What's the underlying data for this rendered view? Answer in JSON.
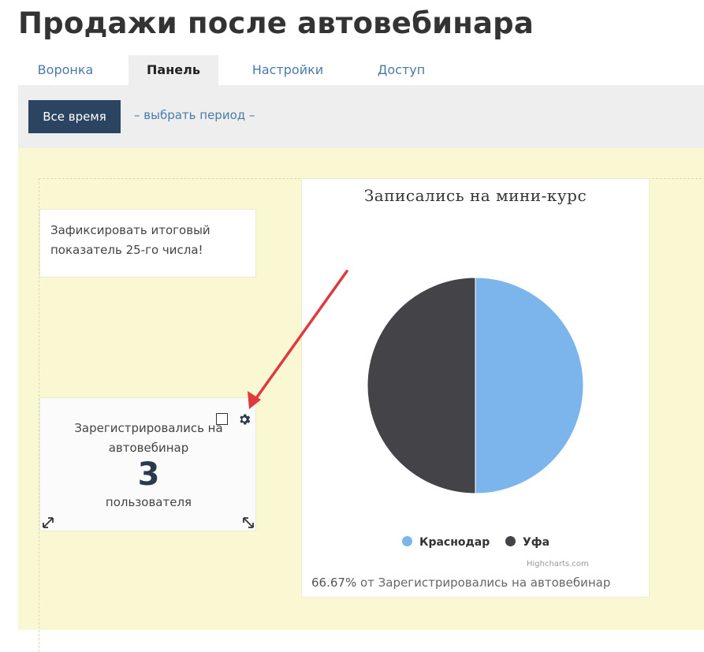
{
  "page": {
    "title": "Продажи после автовебинара"
  },
  "tabs": [
    {
      "label": "Воронка",
      "active": false
    },
    {
      "label": "Панель",
      "active": true
    },
    {
      "label": "Настройки",
      "active": false
    },
    {
      "label": "Доступ",
      "active": false
    }
  ],
  "period": {
    "all_time_label": "Все время",
    "choose_label": "– выбрать период –"
  },
  "note": {
    "text": "Зафиксировать итоговый показатель 25-го числа!"
  },
  "kpi": {
    "title": "Зарегистрировались на автовебинар",
    "value": "3",
    "unit": "пользователя",
    "icons": [
      "checkbox-icon",
      "gear-icon",
      "expand-diagonal-icon",
      "resize-diagonal-icon"
    ]
  },
  "chart_data": {
    "type": "pie",
    "title": "Записались на мини-курс",
    "categories": [
      "Краснодар",
      "Уфа"
    ],
    "values": [
      50,
      50
    ],
    "colors": [
      "#7cb5ec",
      "#434348"
    ],
    "legend_position": "bottom",
    "credits": "Highcharts.com",
    "footnote_percent": "66.67%",
    "footnote_text": "от Зарегистрировались на автовебинар"
  },
  "annotation": {
    "arrow_color": "#e0393e"
  },
  "colors": {
    "accent_button": "#2b4461",
    "link": "#4a7ba6",
    "dashboard_bg": "#f9f8d2"
  }
}
